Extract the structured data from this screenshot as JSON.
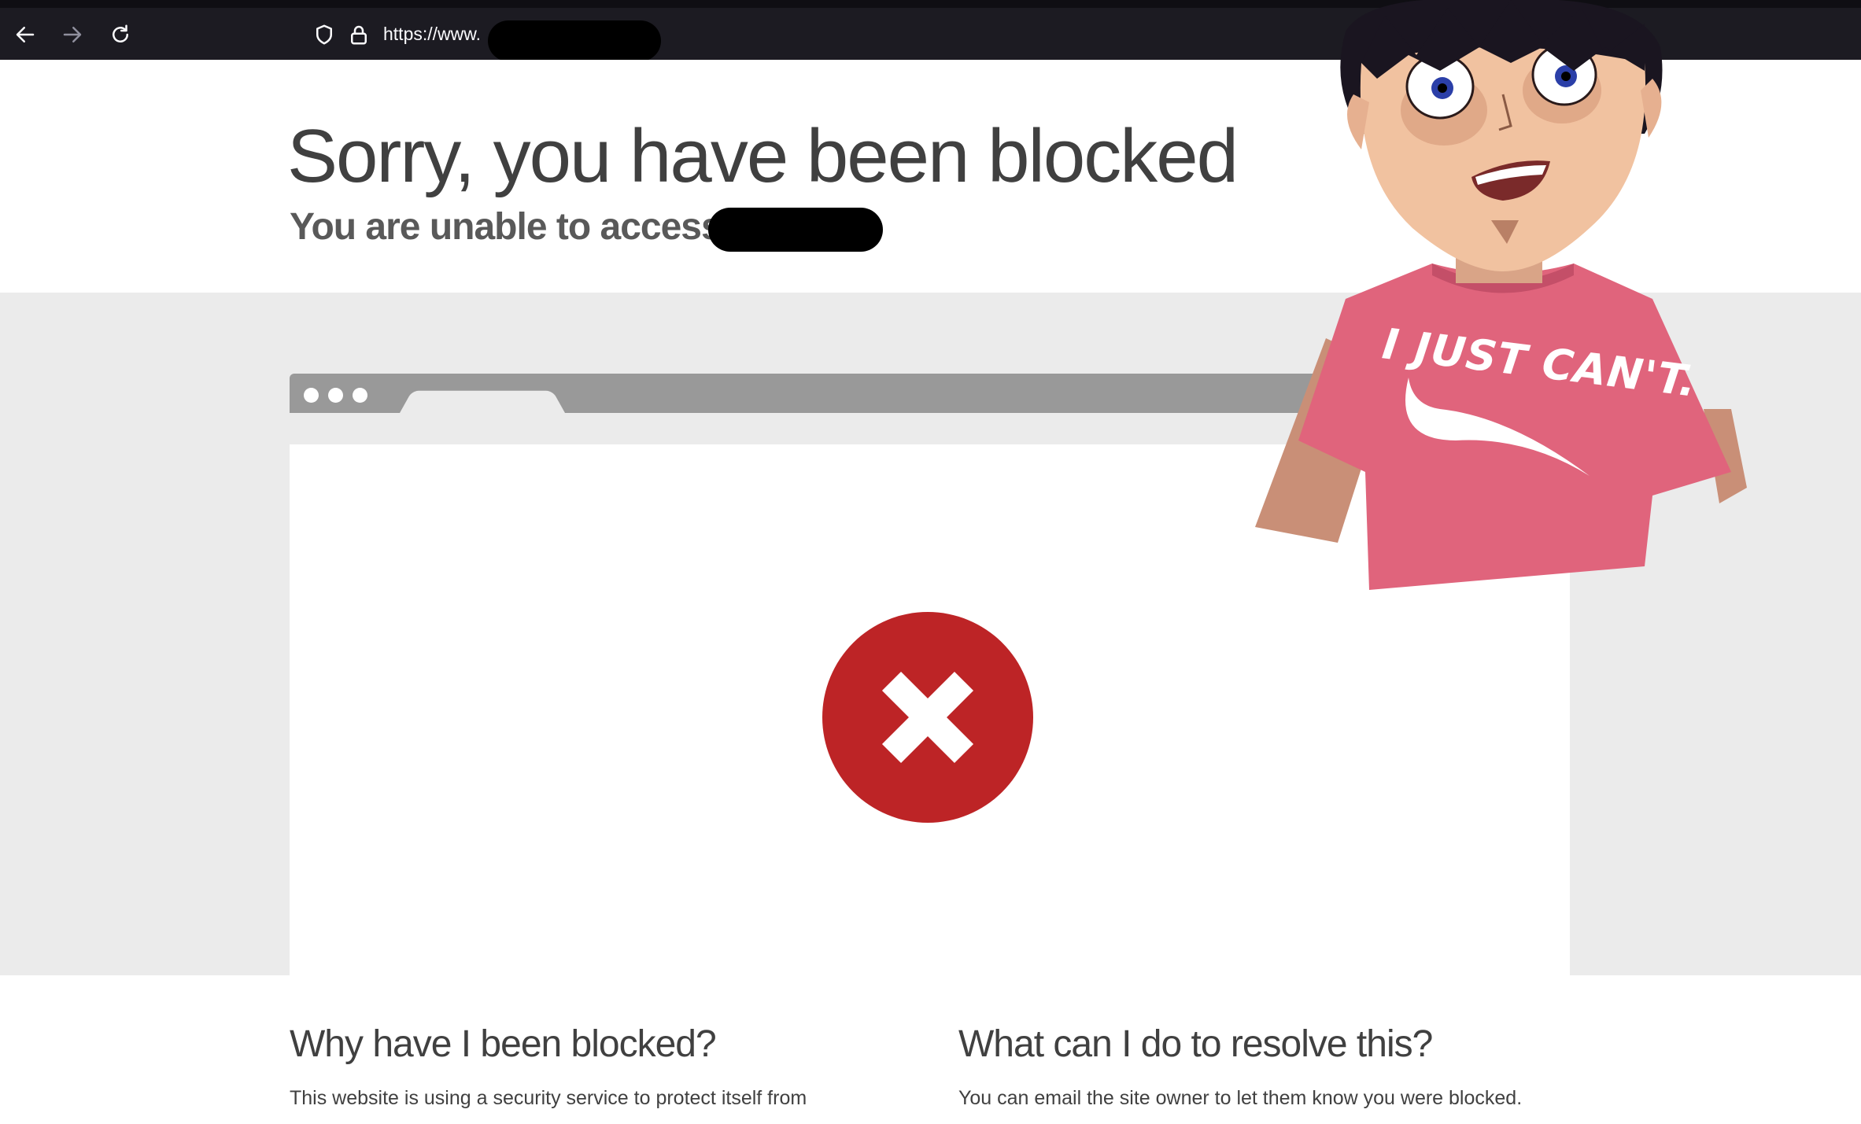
{
  "browser": {
    "url_prefix": "https://www.",
    "icons": [
      "back-arrow-icon",
      "forward-arrow-icon",
      "reload-icon",
      "shield-icon",
      "lock-icon"
    ]
  },
  "header": {
    "title": "Sorry, you have been blocked",
    "subtitle": "You are unable to access"
  },
  "info": {
    "why_heading": "Why have I been blocked?",
    "why_text": "This website is using a security service to protect itself from",
    "resolve_heading": "What can I do to resolve this?",
    "resolve_text": "You can email the site owner to let them know you were blocked."
  },
  "meme": {
    "shirt_text": "I JUST CAN'T."
  },
  "colors": {
    "error_red": "#bd2426",
    "gray_band": "#ebebeb",
    "tab_gray": "#999999",
    "shirt_pink": "#e0647c"
  }
}
